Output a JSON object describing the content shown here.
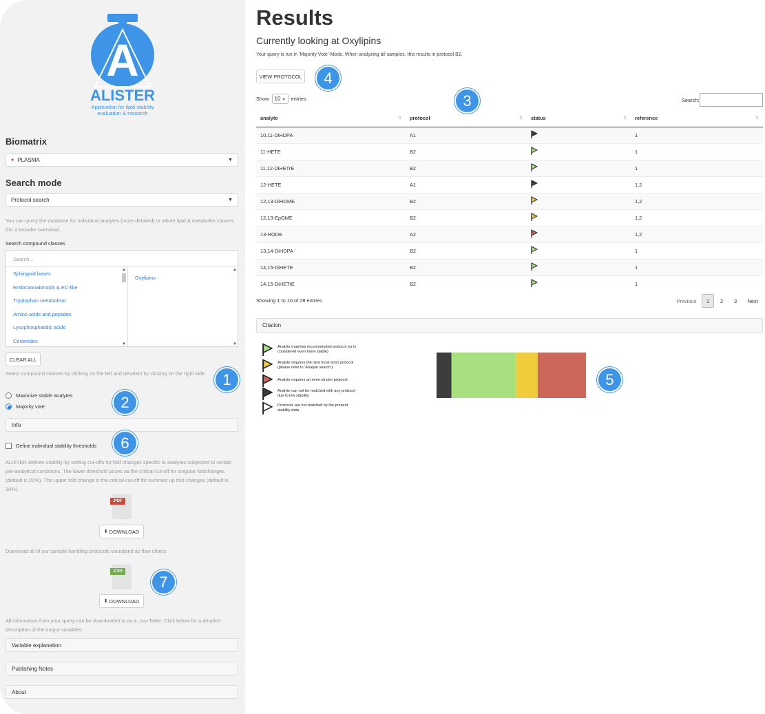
{
  "sidebar": {
    "logo": {
      "letter": "A",
      "name": "ALISTER",
      "tagline_1": "Application for lipid stability",
      "tagline_2": "evaluation & research"
    },
    "biomatrix": {
      "heading": "Biomatrix",
      "value": "PLASMA"
    },
    "search_mode": {
      "heading": "Search mode",
      "value": "Protocol search"
    },
    "query_hint": "You can query the database for individual analytes (more detailed) or whole lipid & metabolite classes (for a broader overview).",
    "compound_classes": {
      "label": "Search compound classes",
      "placeholder": "Search...",
      "available": [
        "Sphingoid bases",
        "Endocannabinoids & EC-like",
        "Tryptophan metabolism",
        "Amino acids and peptides",
        "Lysophosphatidic acids",
        "Ceramides"
      ],
      "selected": [
        "Oxylipins"
      ]
    },
    "clear_all": "CLEAR ALL",
    "select_hint": "Select compound classes by clicking on the left and deselect by clicking on the right side.",
    "radio": {
      "option_1": "Maximize stable analytes",
      "option_2": "Majority vote",
      "selected": "Majority vote"
    },
    "info_panel": "Info",
    "thresholds_checkbox": "Define individual stability thresholds",
    "thresholds_text": "ALISTER defines stability by setting cut-offs for fold changes specific to analytes subjected to certain pre-analytical conditions. The lower threshold poses as the critical cut-off for singular foldchanges (default is 20%). The upper fold change is the critical cut-off for summed up fold changes (default is 30%).",
    "pdf": {
      "tag": ".PDF",
      "button": "DOWNLOAD",
      "hint": "Download all of our sample handling protocols visualized as flow charts."
    },
    "csv": {
      "tag": ".CSV",
      "button": "DOWNLOAD",
      "hint": "All information from your query can be downloaded in as a .csv-Table. Click below for a detailed description of the output variables."
    },
    "panels": [
      "Variable explanation",
      "Publishing Notes",
      "About"
    ]
  },
  "main": {
    "title": "Results",
    "subtitle": "Currently looking at Oxylipins",
    "note": "Your query is run in 'Majority Vote'-Mode. When analyzing all samples, this results in protocol B2.",
    "view_protocol": "VIEW PROTOCOL",
    "show_label": "Show",
    "entries_value": "10",
    "entries_label": "entries",
    "search_label": "Search:",
    "columns": [
      "analyte",
      "protocol",
      "status",
      "reference"
    ],
    "rows": [
      {
        "analyte": "10,11-DiHDPA",
        "protocol": "A1",
        "status": "black",
        "reference": "1"
      },
      {
        "analyte": "11-HETE",
        "protocol": "B2",
        "status": "green",
        "reference": "1"
      },
      {
        "analyte": "11,12-DiHETrE",
        "protocol": "B2",
        "status": "green",
        "reference": "1"
      },
      {
        "analyte": "12-HETE",
        "protocol": "A1",
        "status": "black",
        "reference": "1,2"
      },
      {
        "analyte": "12,13-DiHOME",
        "protocol": "B2",
        "status": "yellow",
        "reference": "1,2"
      },
      {
        "analyte": "12,13-EpOME",
        "protocol": "B2",
        "status": "yellow",
        "reference": "1,2"
      },
      {
        "analyte": "13-HODE",
        "protocol": "A2",
        "status": "red",
        "reference": "1,2"
      },
      {
        "analyte": "13,14-DiHDPA",
        "protocol": "B2",
        "status": "green",
        "reference": "1"
      },
      {
        "analyte": "14,15-DiHETE",
        "protocol": "B2",
        "status": "green",
        "reference": "1"
      },
      {
        "analyte": "14,15-DiHETrE",
        "protocol": "B2",
        "status": "green",
        "reference": "1"
      }
    ],
    "showing": "Showing 1 to 10 of 28 entries",
    "pagination": [
      "Previous",
      "1",
      "2",
      "3",
      "Next"
    ],
    "current_page": "1",
    "citation_panel": "Citation",
    "legend": [
      {
        "flag": "green",
        "text": "Analyte matches recommended protocol (or is considered even more stable)"
      },
      {
        "flag": "yellow",
        "text": "Analyte requires the next most strict protocol (please refer to 'Analyte search')"
      },
      {
        "flag": "red",
        "text": "Analyte requires an even stricter protocol"
      },
      {
        "flag": "black",
        "text": "Analyte can not be matched with any protocol due to low stability"
      },
      {
        "flag": "white",
        "text": "Protocols are not matched by the present stability data"
      }
    ],
    "status_bar": [
      {
        "label": "black",
        "fraction": 0.1
      },
      {
        "label": "green",
        "fraction": 0.4333
      },
      {
        "label": "yellow",
        "fraction": 0.1433
      },
      {
        "label": "red",
        "fraction": 0.3233
      }
    ]
  },
  "markers": [
    "1",
    "2",
    "3",
    "4",
    "5",
    "6",
    "7"
  ],
  "colors": {
    "accent": "#2a7ae2",
    "marker": "#3e95e8",
    "green": "#a8e07f",
    "yellow": "#f0cc3d",
    "red": "#cc6659",
    "black": "#3d3d3d",
    "white": "#ffffff"
  }
}
